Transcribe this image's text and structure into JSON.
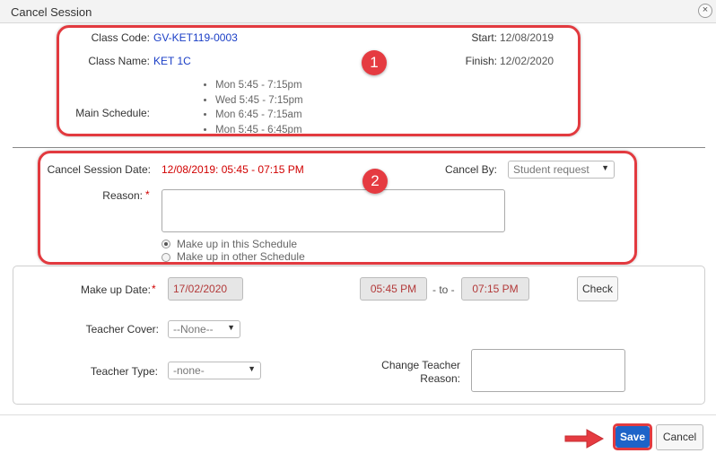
{
  "dialog": {
    "title": "Cancel Session",
    "close_icon": "close-icon"
  },
  "class_info": {
    "code_label": "Class Code:",
    "code_value": "GV-KET119-0003",
    "name_label": "Class Name:",
    "name_value": "KET 1C",
    "start_label": "Start:",
    "start_value": "12/08/2019",
    "finish_label": "Finish:",
    "finish_value": "12/02/2020",
    "schedule_label": "Main Schedule:",
    "schedule": [
      "Mon 5:45 - 7:15pm",
      "Wed 5:45 - 7:15pm",
      "Mon 6:45 - 7:15am",
      "Mon 5:45 - 6:45pm"
    ]
  },
  "annotations": {
    "badge1": "1",
    "badge2": "2",
    "highlight_color": "#e23a3f"
  },
  "cancel_form": {
    "date_label": "Cancel Session Date:",
    "date_value": "12/08/2019: 05:45 - 07:15 PM",
    "cancel_by_label": "Cancel By:",
    "cancel_by_value": "Student request",
    "reason_label": "Reason:",
    "required_mark": "*",
    "reason_value": "",
    "radio_this": "Make up in this Schedule",
    "radio_other": "Make up in other Schedule",
    "selected_option": "Make up in this Schedule"
  },
  "makeup": {
    "date_label": "Make up Date:",
    "required_mark": "*",
    "date_value": "17/02/2020",
    "time_from": "05:45 PM",
    "to_label": "- to -",
    "time_to": "07:15 PM",
    "check_label": "Check",
    "teacher_cover_label": "Teacher Cover:",
    "teacher_cover_value": "--None--",
    "teacher_type_label": "Teacher Type:",
    "teacher_type_value": "-none-",
    "change_reason_label_1": "Change Teacher",
    "change_reason_label_2": "Reason:",
    "change_reason_value": ""
  },
  "footer": {
    "save_label": "Save",
    "cancel_label": "Cancel",
    "accent": "#1d63c8",
    "pointer_icon": "arrow-right-icon"
  }
}
